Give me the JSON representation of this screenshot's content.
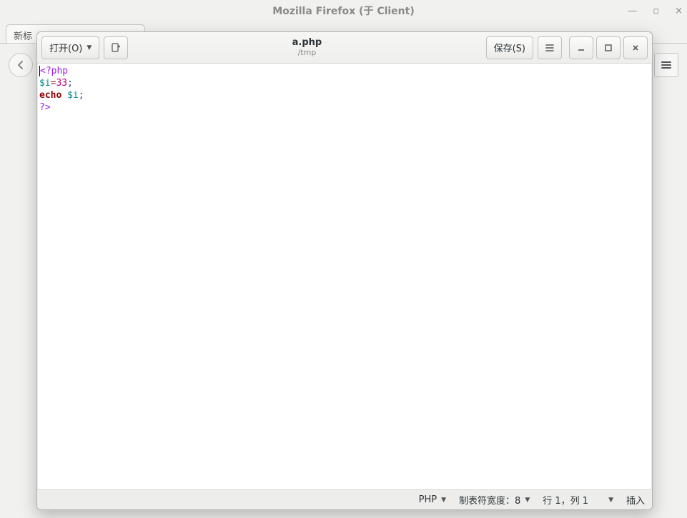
{
  "firefox": {
    "title": "Mozilla Firefox (于  Client)",
    "tab_label": "新标",
    "winctrl": {
      "min": "—",
      "max": "▫",
      "close": "×"
    }
  },
  "gedit": {
    "header": {
      "open_label": "打开(O)",
      "save_label": "保存(S)",
      "filename": "a.php",
      "path": "/tmp"
    },
    "code": {
      "l1_open": "<?php",
      "l2_var": "$i",
      "l2_assign": "=",
      "l2_num": "33",
      "l2_semi": ";",
      "l3_kw": "echo",
      "l3_var": "$i",
      "l3_semi": ";",
      "l4_close": "?>"
    },
    "status": {
      "lang": "PHP",
      "tabwidth": "制表符宽度：8",
      "rowcol": "行 1，列 1",
      "insert_mode": "插入"
    }
  }
}
